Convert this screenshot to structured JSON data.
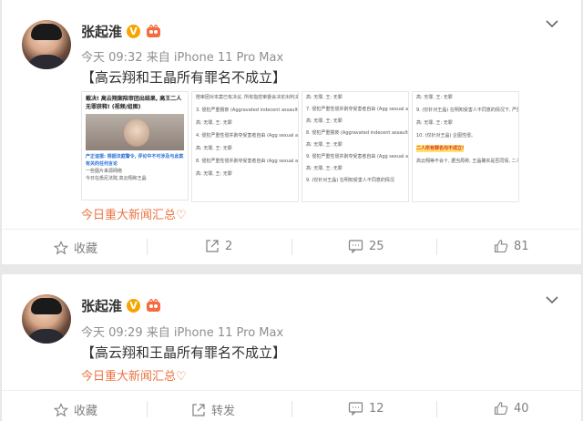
{
  "posts": [
    {
      "username": "张起淮",
      "timestamp": "今天 09:32 来自 iPhone 11 Pro Max",
      "text": "【高云翔和王晶所有罪名不成立】",
      "topic": "今日重大新闻汇总♡",
      "actions": {
        "favorite": "收藏",
        "repost": "2",
        "comment": "25",
        "like": "81"
      },
      "thumbnails": [
        {
          "headline": "截决! 高云翔案陪审团出结果, 高王二人无罪获释! (视频/组图)",
          "caption": "产正谊报: 根据法庭警令, 评论中不可涉及与此案有关的任何言论",
          "lines": [
            "一些图片来源网络",
            "今日在悉尼法院,高云翔和王晶"
          ]
        },
        {
          "lines": [
            "陪审团对本案已有决议, 所有指控审委会决定出判决。",
            "3. 侵犯严重猥亵 (Aggravated indecent assault - offender in company)",
            "高: 无罪, 王: 无罪",
            "4. 侵犯严重性侵并剥夺受害者自由 (Agg sexual assault in company and deprive liberty - s)",
            "高: 无罪, 王: 无罪",
            "8. 侵犯严重性侵并剥夺受害者自由 (Agg sexual assault in company and deprive liberty - s)",
            "高: 无罪, 王: 无罪"
          ]
        },
        {
          "lines": [
            "高: 无罪, 王: 无罪",
            "7. 侵犯严重性侵并剥夺受害者自由 (Agg sexual assault in company and deprive liberty - s)",
            "高: 无罪, 王: 无罪",
            "8. 侵犯严重猥亵 (Aggravated indecent assault - offender in company - t1)",
            "高: 无罪, 王: 无罪",
            "9. 侵犯严重性侵并剥夺受害者自由 (Agg sexual assault in company and deprive liberty - s)",
            "高: 无罪, 王: 无罪",
            "9. (仅针对王晶) 在明知受害人不同意的情况"
          ]
        },
        {
          "lines": [
            "高: 无罪, 王: 无罪",
            "9. (仅针对王晶) 在明知受害人不同意的情况下, 严重性侵,",
            "高: 无罪, 王: 无罪",
            "10. (仅针对王晶) 企图性侵。",
            "二人所有罪名均不成立!",
            "高云翔等不会十, 据当局称, 王晶确实是否同情, 二人均有重读等唱一首?"
          ]
        }
      ]
    },
    {
      "username": "张起淮",
      "timestamp": "今天 09:29 来自 iPhone 11 Pro Max",
      "text": "【高云翔和王晶所有罪名不成立】",
      "topic": "今日重大新闻汇总♡",
      "actions": {
        "favorite": "收藏",
        "repost": "转发",
        "comment": "12",
        "like": "40"
      }
    }
  ],
  "colors": {
    "topic": "#eb7340",
    "vbadge": "#f7a400",
    "meta": "#8f8f8f"
  }
}
